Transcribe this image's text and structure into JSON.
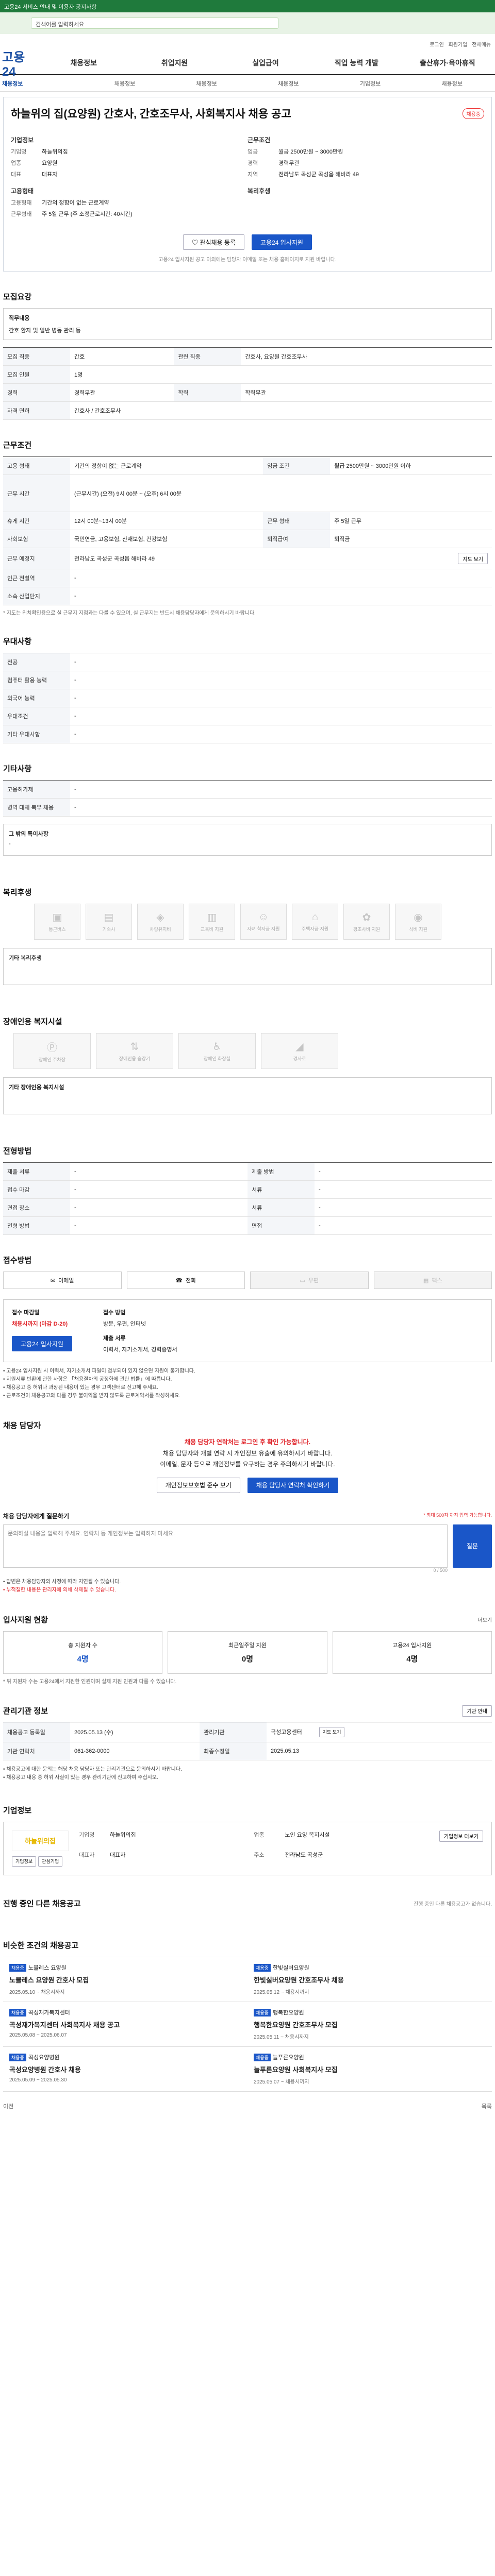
{
  "topbar": {
    "notice": "고용24 서비스 안내 및 이용자 공지사항"
  },
  "search": {
    "value": "검색어를 입력하세요"
  },
  "util": [
    "로그인",
    "회원가입",
    "전체메뉴"
  ],
  "gnb": {
    "logo": "고용24",
    "items": [
      "채용정보",
      "취업지원",
      "실업급여",
      "직업 능력 개발",
      "출산휴가·육아휴직"
    ]
  },
  "lnb": [
    "채용정보",
    "채용정보",
    "채용정보",
    "채용정보",
    "기업정보",
    "채용정보"
  ],
  "job": {
    "title": "하늘위의 집(요양원) 간호사, 간호조무사, 사회복지사 채용 공고",
    "badge": "채용중",
    "company_head": "기업정보",
    "company": [
      {
        "k": "기업명",
        "v": "하늘위의집"
      },
      {
        "k": "업종",
        "v": "요양원"
      },
      {
        "k": "대표",
        "v": "대표자"
      }
    ],
    "cond_head": "근무조건",
    "cond": [
      {
        "k": "임금",
        "v": "월급 2500만원 ~ 3000만원"
      },
      {
        "k": "경력",
        "v": "경력무관"
      },
      {
        "k": "지역",
        "v": "전라남도 곡성군 곡성읍 해바라 49"
      }
    ],
    "type_head": "고용형태",
    "type": [
      {
        "k": "고용형태",
        "v": "기간의 정함이 없는 근로계약"
      },
      {
        "k": "근무형태",
        "v": "주 5일 근무 (주 소정근로시간: 40시간)"
      }
    ],
    "welfare_head": "복리후생",
    "btn_scrap": "관심채용 등록",
    "btn_apply": "고용24 입사지원",
    "btn_note": "고용24 입사지원 공고 이외에는 담당자 이메일 또는 채용 홈페이지로 지원 바랍니다."
  },
  "sections": {
    "recruit": {
      "title": "모집요강",
      "duty_label": "직무내용",
      "duty": "간호 환자 및 일반 병동 관리 등",
      "rows": [
        {
          "k": "모집 직종",
          "v": "간호",
          "k2": "관련 직종",
          "v2": "간호사, 요양원 간호조무사"
        },
        {
          "k": "모집 인원",
          "v": "1명",
          "k2": "",
          "v2": ""
        },
        {
          "k": "경력",
          "v": "경력무관",
          "k2": "학력",
          "v2": "학력무관"
        },
        {
          "k": "자격 면허",
          "v": "간호사 / 간호조무사",
          "k2": "",
          "v2": ""
        }
      ]
    },
    "work": {
      "title": "근무조건",
      "rows": [
        {
          "k": "고용 형태",
          "v": "기간의 정함이 없는 근로계약",
          "k2": "임금 조건",
          "v2": "월급 2500만원 ~ 3000만원 이하"
        },
        {
          "k": "근무 시간",
          "v": "(근무시간) (오전) 9시 00분 ~ (오후) 6시 00분",
          "k2": "",
          "v2": ""
        },
        {
          "k": "휴게 시간",
          "v": "12시 00분~13시 00분",
          "k2": "근무 형태",
          "v2": "주 5일 근무"
        },
        {
          "k": "사회보험",
          "v": "국민연금, 고용보험, 산재보험, 건강보험",
          "k2": "퇴직급여",
          "v2": "퇴직금"
        },
        {
          "k": "근무 예정지",
          "v": "전라남도 곡성군 곡성읍 해바라 49",
          "k2": "",
          "v2": ""
        },
        {
          "k": "인근 전철역",
          "v": "-",
          "k2": "",
          "v2": ""
        },
        {
          "k": "소속 산업단지",
          "v": "-",
          "k2": "",
          "v2": ""
        }
      ],
      "note": "* 지도는 위치확인용으로 실 근무지 지점과는 다를 수 있으며, 실 근무지는 반드시 채용담당자에게 문의하시기 바랍니다.",
      "map_btn": "지도 보기"
    },
    "etc": {
      "title": "우대사항",
      "rows": [
        {
          "k": "전공",
          "v": "-"
        },
        {
          "k": "컴퓨터 활용 능력",
          "v": "-"
        },
        {
          "k": "외국어 능력",
          "v": "-"
        },
        {
          "k": "우대조건",
          "v": "-"
        },
        {
          "k": "기타 우대사항",
          "v": "-"
        }
      ]
    },
    "extra": {
      "title": "기타사항",
      "rows": [
        {
          "k": "고용허가제",
          "v": "-"
        },
        {
          "k": "병역 대체 복무 채용",
          "v": "-"
        }
      ],
      "note_label": "그 밖의 특이사항",
      "note": "-"
    },
    "welfare": {
      "title": "복리후생",
      "items": [
        "통근버스",
        "기숙사",
        "차량유지비",
        "교육비 지원",
        "자녀 학자금 지원",
        "주택자금 지원",
        "경조사비 지원",
        "식비 지원"
      ],
      "etc_label": "기타 복리후생"
    },
    "disabled": {
      "title": "장애인용 복지시설",
      "items": [
        "장애인 주차장",
        "장애인용 승강기",
        "장애인 화장실",
        "경사로"
      ],
      "etc_label": "기타 장애인용 복지시설"
    },
    "process": {
      "title": "전형방법",
      "rows": [
        {
          "k": "제출 서류",
          "v": "-",
          "k2": "제출 방법",
          "v2": "-"
        },
        {
          "k": "접수 마감",
          "v": "-",
          "k2": "서류",
          "v2": "-"
        },
        {
          "k": "면접 장소",
          "v": "-",
          "k2": "서류",
          "v2": "-"
        },
        {
          "k": "전형 방법",
          "v": "-",
          "k2": "면접",
          "v2": "-"
        }
      ]
    },
    "contact": {
      "title": "접수방법",
      "buttons": [
        "이메일",
        "전화",
        "우편",
        "팩스"
      ],
      "apply_label": "접수 마감일",
      "deadline": "채용시까지 (마감 D-20)",
      "method_label": "접수 방법",
      "methods": "방문, 우편, 인터넷",
      "docs_label": "제출 서류",
      "docs": "이력서, 자기소개서, 경력증명서",
      "apply_btn": "고용24 입사지원",
      "bullets": [
        "고용24 입사지원 시 이력서, 자기소개서 파일이 첨부되어 있지 않으면 지원이 불가합니다.",
        "지원서류 반환에 관한 사항은 「채용절차의 공정화에 관한 법률」에 따릅니다.",
        "채용공고 중 허위나 과장된 내용이 있는 경우 고객센터로 신고해 주세요.",
        "근로조건이 채용공고와 다를 경우 불이익을 받지 않도록 근로계약서를 작성하세요."
      ]
    },
    "manager": {
      "title": "채용 담당자",
      "msg1": "채용 담당자 연락처는 로그인 후 확인 가능합니다.",
      "msg2": "채용 담당자와 개별 연락 시 개인정보 유출에 유의하시기 바랍니다.",
      "msg3": "이메일, 문자 등으로 개인정보를 요구하는 경우 주의하시기 바랍니다.",
      "btn1": "개인정보보호법 준수 보기",
      "btn2": "채용 담당자 연락처 확인하기"
    },
    "qna": {
      "title": "채용 담당자에게 질문하기",
      "counter_note": "* 최대 500자 까지 입력 가능합니다.",
      "placeholder": "문의하실 내용을 입력해 주세요. 연락처 등 개인정보는 입력하지 마세요.",
      "count": "0 / 500",
      "btn": "질문",
      "notes": [
        "답변은 채용담당자의 사정에 따라 지연될 수 있습니다.",
        "부적절한 내용은 관리자에 의해 삭제될 수 있습니다."
      ]
    },
    "stats": {
      "title": "입사지원 현황",
      "more": "더보기",
      "items": [
        {
          "label": "총 지원자 수",
          "value": "4명"
        },
        {
          "label": "최근일주일 지원",
          "value": "0명"
        },
        {
          "label": "고용24 입사지원",
          "value": "4명"
        }
      ],
      "note": "* 위 지원자 수는 고용24에서 지원한 인원이며 실제 지원 인원과 다를 수 있습니다."
    },
    "info": {
      "title": "관리기관 정보",
      "btn": "기관 안내",
      "rows": [
        {
          "k": "채용공고 등록일",
          "v": "2025.05.13 (수)",
          "k2": "관리기관",
          "v2": "곡성고용센터"
        },
        {
          "k": "기관 연락처",
          "v": "061-362-0000",
          "k2": "최종수정일",
          "v2": "2025.05.13"
        }
      ],
      "map_btn": "지도 보기",
      "notes": [
        "채용공고에 대한 문의는 해당 채용 담당자 또는 관리기관으로 문의하시기 바랍니다.",
        "채용공고 내용 중 허위 사실이 있는 경우 관리기관에 신고하여 주십시오."
      ]
    },
    "company": {
      "title": "기업정보",
      "logo": "하늘위의집",
      "btn1": "기업정보",
      "btn2": "관심기업",
      "rows": [
        {
          "k": "기업명",
          "v": "하늘위의집"
        },
        {
          "k": "업종",
          "v": "노인 요양 복지시설"
        },
        {
          "k": "대표자",
          "v": "대표자"
        },
        {
          "k": "주소",
          "v": "전라남도 곡성군"
        }
      ],
      "more_btn": "기업정보 더보기"
    },
    "others": {
      "title": "진행 중인 다른 채용공고",
      "empty": "진행 중인 다른 채용공고가 없습니다."
    },
    "similar": {
      "title": "비슷한 조건의 채용공고",
      "cards": [
        {
          "tag": "채용중",
          "company": "노블레스 요양원",
          "title": "노블레스 요양원 간호사 모집",
          "date": "2025.05.10 ~ 채용시까지"
        },
        {
          "tag": "채용중",
          "company": "한빛실버요양원",
          "title": "한빛실버요양원 간호조무사 채용",
          "date": "2025.05.12 ~ 채용시까지"
        },
        {
          "tag": "채용중",
          "company": "곡성재가복지센터",
          "title": "곡성재가복지센터 사회복지사 채용 공고",
          "date": "2025.05.08 ~ 2025.06.07"
        },
        {
          "tag": "채용중",
          "company": "행복한요양원",
          "title": "행복한요양원 간호조무사 모집",
          "date": "2025.05.11 ~ 채용시까지"
        },
        {
          "tag": "채용중",
          "company": "곡성요양병원",
          "title": "곡성요양병원 간호사 채용",
          "date": "2025.05.09 ~ 2025.05.30"
        },
        {
          "tag": "채용중",
          "company": "늘푸른요양원",
          "title": "늘푸른요양원 사회복지사 모집",
          "date": "2025.05.07 ~ 채용시까지"
        }
      ]
    },
    "bottom": {
      "prev": "이전",
      "list": "목록"
    }
  }
}
